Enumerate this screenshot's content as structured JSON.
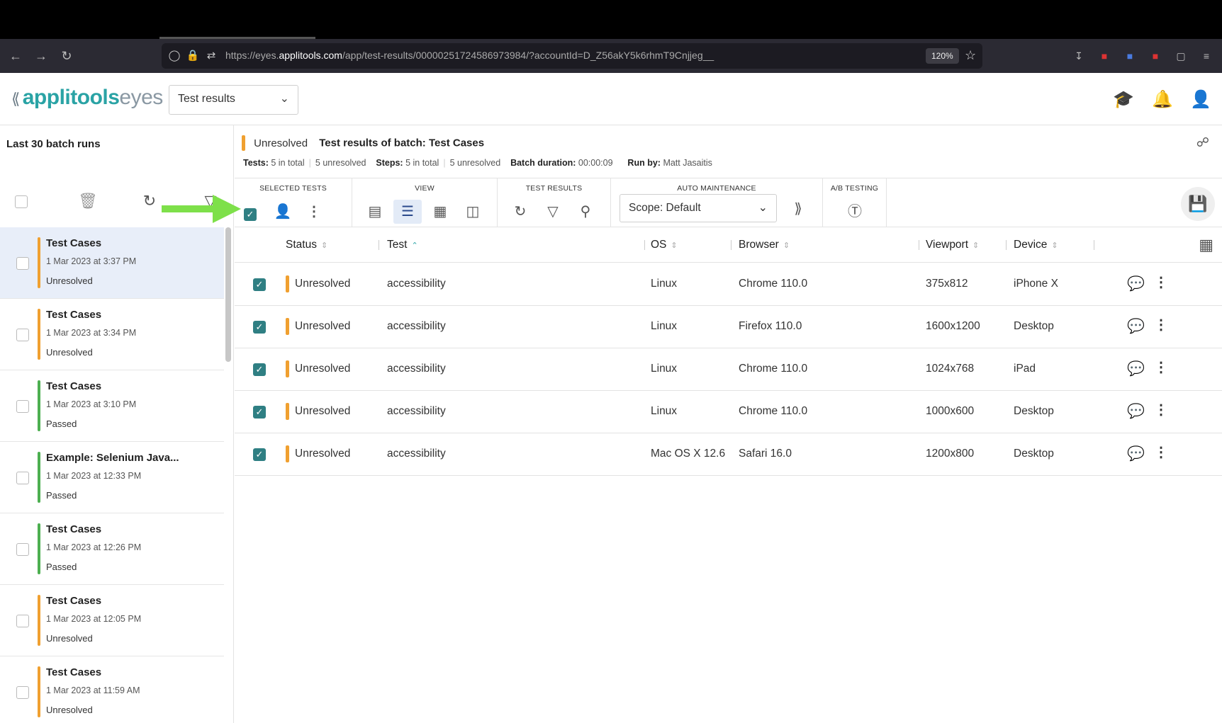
{
  "browser": {
    "url_prefix": "https://eyes.",
    "url_domain": "applitools.com",
    "url_path": "/app/test-results/00000251724586973984/?accountId=D_Z56akY5k6rhmT9Cnjjeg__",
    "zoom": "120%"
  },
  "header": {
    "logo_primary": "applitools",
    "logo_secondary": "eyes",
    "workspace_select": "Test results"
  },
  "left_panel": {
    "title": "Last 30 batch runs",
    "batches": [
      {
        "name": "Test Cases",
        "date": "1 Mar 2023 at 3:37 PM",
        "status": "Unresolved",
        "color": "#f0a030",
        "active": true
      },
      {
        "name": "Test Cases",
        "date": "1 Mar 2023 at 3:34 PM",
        "status": "Unresolved",
        "color": "#f0a030"
      },
      {
        "name": "Test Cases",
        "date": "1 Mar 2023 at 3:10 PM",
        "status": "Passed",
        "color": "#4caf50"
      },
      {
        "name": "Example: Selenium Java...",
        "date": "1 Mar 2023 at 12:33 PM",
        "status": "Passed",
        "color": "#4caf50"
      },
      {
        "name": "Test Cases",
        "date": "1 Mar 2023 at 12:26 PM",
        "status": "Passed",
        "color": "#4caf50"
      },
      {
        "name": "Test Cases",
        "date": "1 Mar 2023 at 12:05 PM",
        "status": "Unresolved",
        "color": "#f0a030"
      },
      {
        "name": "Test Cases",
        "date": "1 Mar 2023 at 11:59 AM",
        "status": "Unresolved",
        "color": "#f0a030"
      }
    ]
  },
  "summary": {
    "status": "Unresolved",
    "title_prefix": "Test results of batch:",
    "batch_name": "Test Cases",
    "tests_label": "Tests:",
    "tests_total": "5 in total",
    "tests_unresolved": "5 unresolved",
    "steps_label": "Steps:",
    "steps_total": "5 in total",
    "steps_unresolved": "5 unresolved",
    "duration_label": "Batch duration:",
    "duration": "00:00:09",
    "runby_label": "Run by:",
    "runby": "Matt Jasaitis"
  },
  "toolbar": {
    "selected_tests": "SELECTED TESTS",
    "view": "VIEW",
    "test_results": "TEST RESULTS",
    "auto_maintenance": "AUTO MAINTENANCE",
    "ab_testing": "A/B TESTING",
    "scope": "Scope: Default"
  },
  "table": {
    "columns": {
      "status": "Status",
      "test": "Test",
      "os": "OS",
      "browser": "Browser",
      "viewport": "Viewport",
      "device": "Device"
    },
    "rows": [
      {
        "status": "Unresolved",
        "test": "accessibility",
        "os": "Linux",
        "browser": "Chrome 110.0",
        "viewport": "375x812",
        "device": "iPhone X"
      },
      {
        "status": "Unresolved",
        "test": "accessibility",
        "os": "Linux",
        "browser": "Firefox 110.0",
        "viewport": "1600x1200",
        "device": "Desktop"
      },
      {
        "status": "Unresolved",
        "test": "accessibility",
        "os": "Linux",
        "browser": "Chrome 110.0",
        "viewport": "1024x768",
        "device": "iPad"
      },
      {
        "status": "Unresolved",
        "test": "accessibility",
        "os": "Linux",
        "browser": "Chrome 110.0",
        "viewport": "1000x600",
        "device": "Desktop"
      },
      {
        "status": "Unresolved",
        "test": "accessibility",
        "os": "Mac OS X 12.6",
        "browser": "Safari 16.0",
        "viewport": "1200x800",
        "device": "Desktop"
      }
    ]
  },
  "colors": {
    "accent": "#2aa3a5",
    "unresolved": "#f0a030",
    "passed": "#4caf50",
    "annotation_arrow": "#7ee04a"
  }
}
